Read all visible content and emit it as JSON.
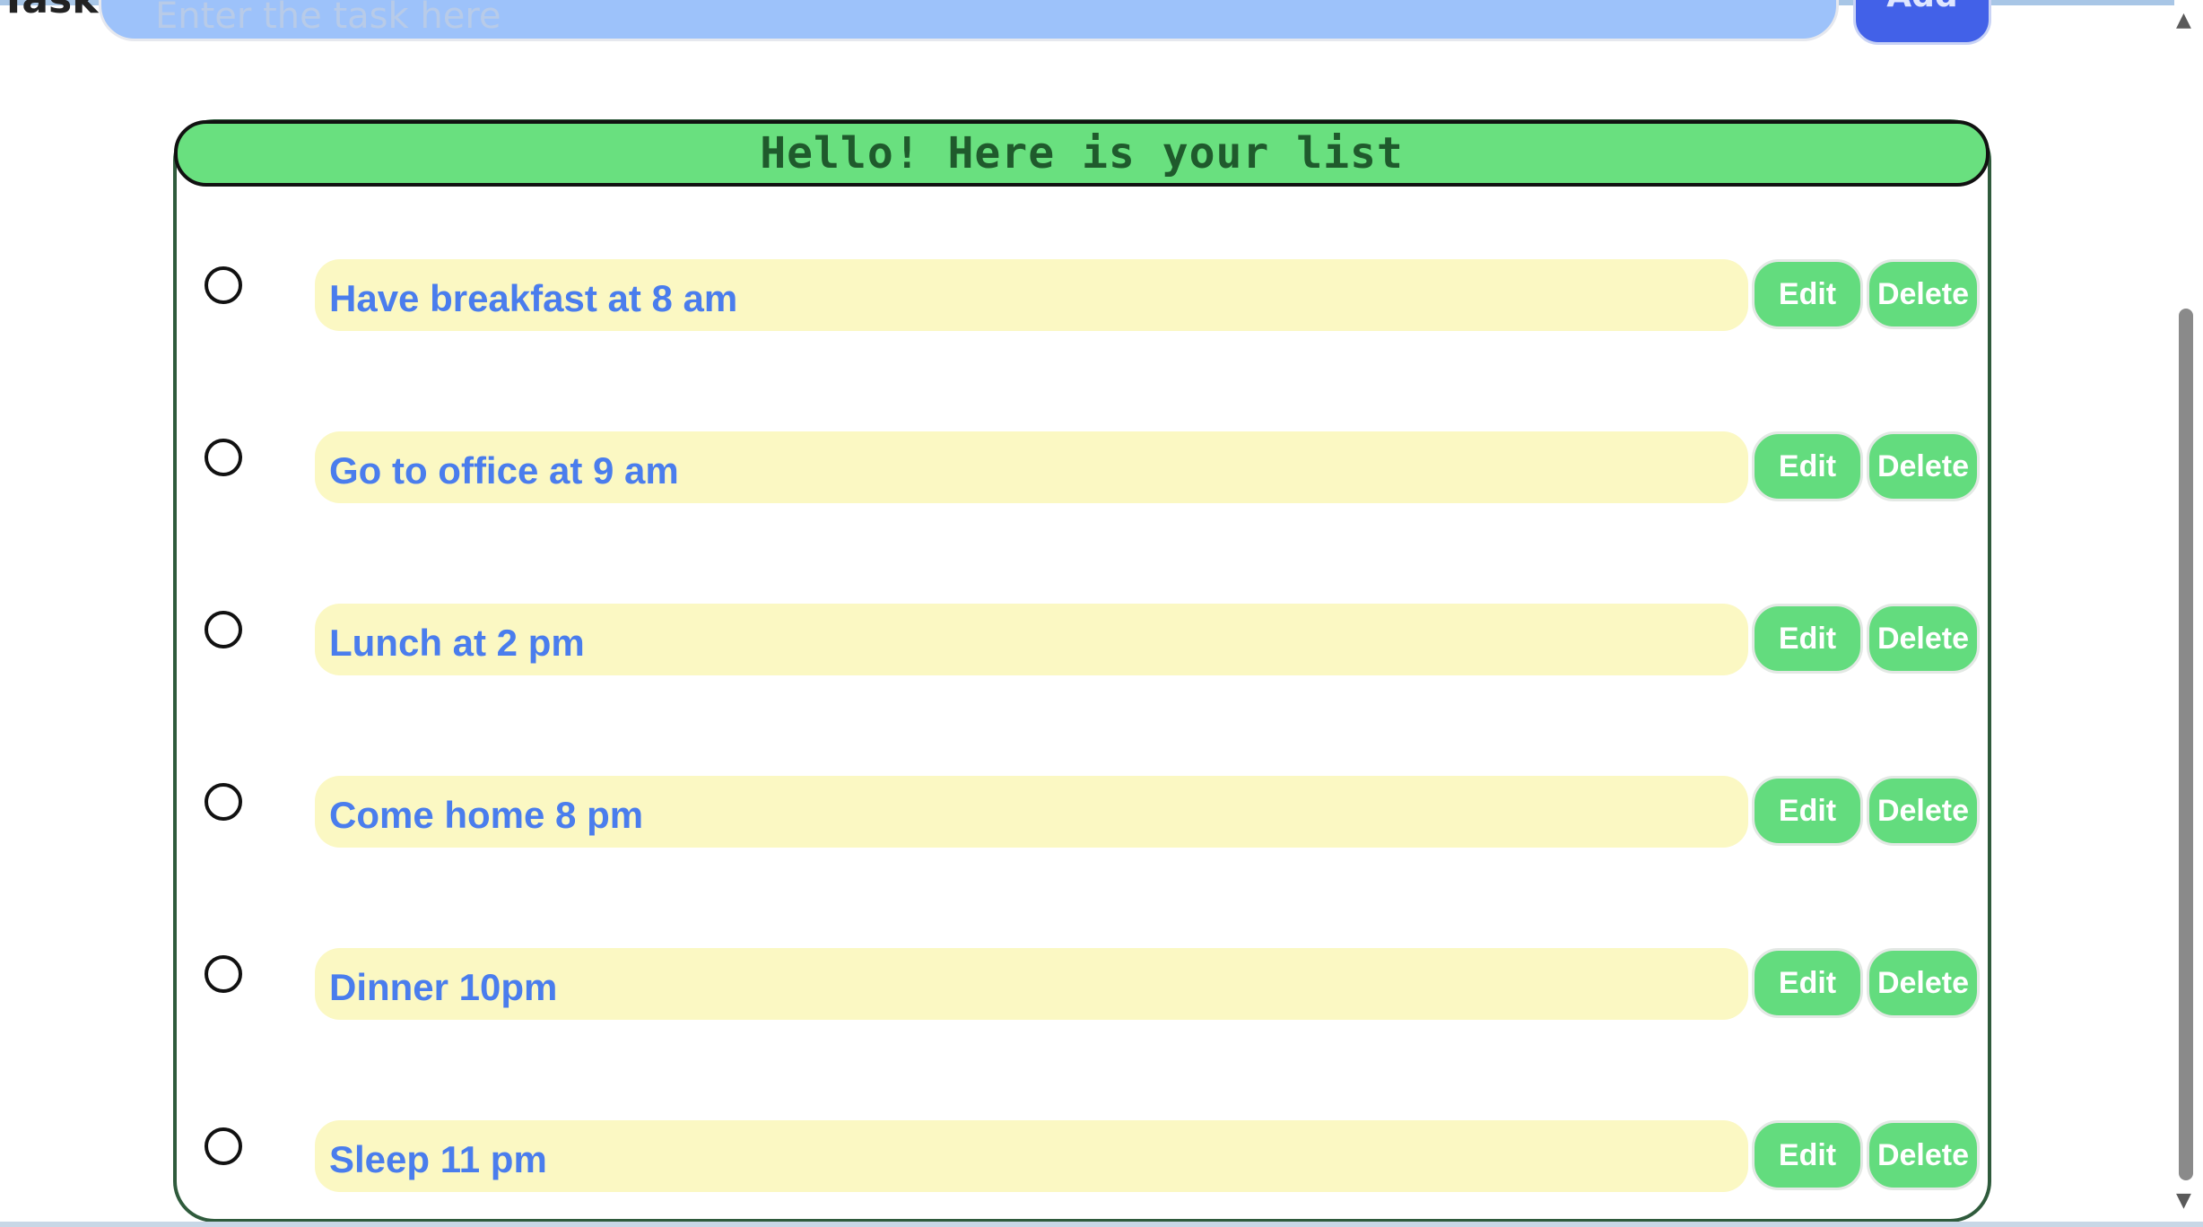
{
  "input_area": {
    "label": "Task",
    "placeholder": "Enter the task here",
    "add_label": "Add"
  },
  "list": {
    "header": "Hello! Here is your list",
    "edit_label": "Edit",
    "delete_label": "Delete",
    "items": [
      {
        "text": "Have breakfast at 8 am",
        "done": false
      },
      {
        "text": "Go to office at 9 am",
        "done": false
      },
      {
        "text": "Lunch at 2 pm",
        "done": false
      },
      {
        "text": "Come home 8 pm",
        "done": false
      },
      {
        "text": "Dinner 10pm",
        "done": false
      },
      {
        "text": "Sleep 11 pm",
        "done": false
      }
    ]
  },
  "colors": {
    "header_bg": "#69e07f",
    "task_bg": "#fbf8c3",
    "task_text": "#4a7ded",
    "button_bg": "#63dc7e",
    "input_bg": "#9dc2fa",
    "add_button_bg": "#4261e8"
  }
}
